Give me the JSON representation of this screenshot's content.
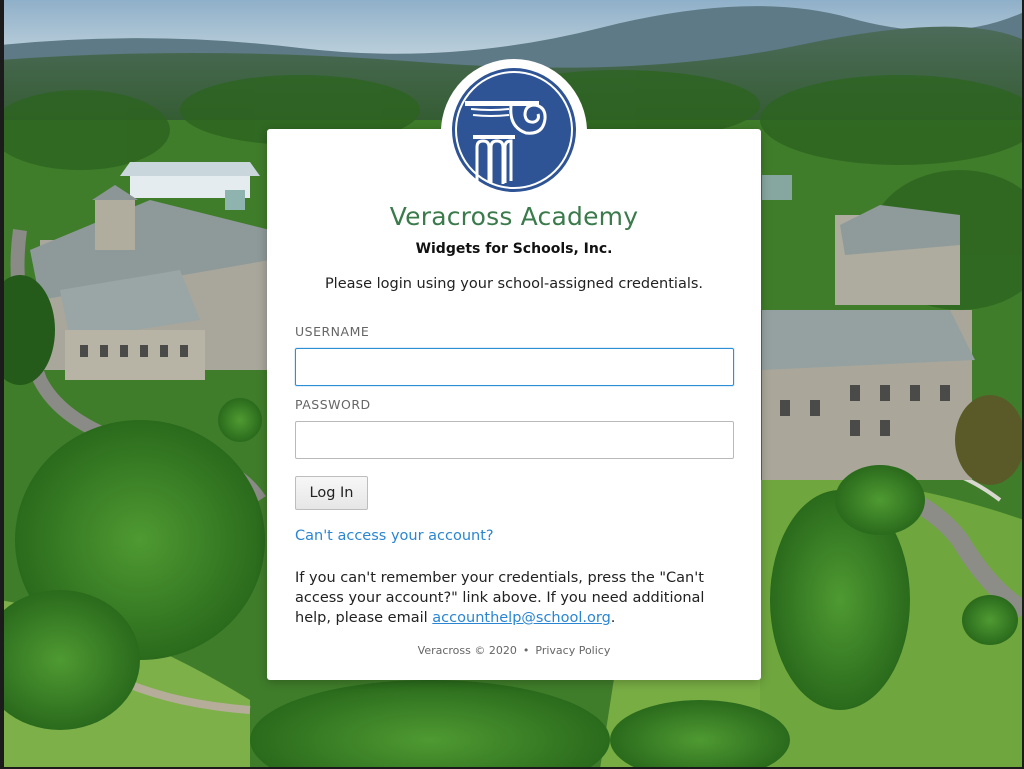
{
  "school": {
    "name": "Veracross Academy",
    "organization": "Widgets for Schools, Inc.",
    "instruction": "Please login using your school-assigned credentials."
  },
  "form": {
    "username_label": "USERNAME",
    "username_value": "",
    "password_label": "PASSWORD",
    "password_value": "",
    "login_button": "Log In",
    "cant_access_link": "Can't access your account?",
    "help_text_before": "If you can't remember your credentials, press the \"Can't access your account?\" link above. If you need additional help, please email ",
    "help_email": "accounthelp@school.org",
    "help_text_after": "."
  },
  "footer": {
    "copyright": "Veracross © 2020",
    "separator": "•",
    "privacy": "Privacy Policy"
  },
  "colors": {
    "brand_green": "#3a7a4b",
    "logo_blue": "#2f5495",
    "link_blue": "#2a86d2",
    "focus_border": "#2d8fd5"
  },
  "icons": {
    "logo": "ionic-column-icon"
  }
}
